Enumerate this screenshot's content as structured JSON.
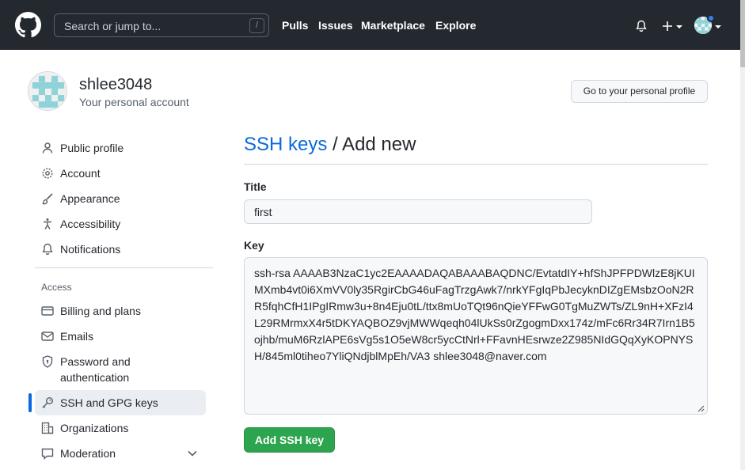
{
  "header": {
    "search_placeholder": "Search or jump to...",
    "search_shortcut": "/",
    "nav": [
      "Pulls",
      "Issues",
      "Marketplace",
      "Explore"
    ]
  },
  "profile": {
    "username": "shlee3048",
    "subtitle": "Your personal account",
    "go_profile_label": "Go to your personal profile"
  },
  "sidebar": {
    "items": [
      {
        "label": "Public profile",
        "icon": "person-icon"
      },
      {
        "label": "Account",
        "icon": "gear-icon"
      },
      {
        "label": "Appearance",
        "icon": "paintbrush-icon"
      },
      {
        "label": "Accessibility",
        "icon": "accessibility-icon"
      },
      {
        "label": "Notifications",
        "icon": "bell-icon"
      }
    ],
    "access_heading": "Access",
    "access_items": [
      {
        "label": "Billing and plans",
        "icon": "credit-card-icon"
      },
      {
        "label": "Emails",
        "icon": "mail-icon"
      },
      {
        "label": "Password and authentication",
        "icon": "shield-lock-icon"
      },
      {
        "label": "SSH and GPG keys",
        "icon": "key-icon",
        "active": true
      },
      {
        "label": "Organizations",
        "icon": "organization-icon"
      },
      {
        "label": "Moderation",
        "icon": "moderation-icon"
      }
    ]
  },
  "main": {
    "title_link": "SSH keys",
    "title_rest": "/ Add new",
    "title_label": "Title",
    "title_value": "first",
    "key_label": "Key",
    "key_value": "ssh-rsa AAAAB3NzaC1yc2EAAAADAQABAAABAQDNC/EvtatdIY+hfShJPFPDWlzE8jKUIMXmb4vt0i6XmVV0ly35RgirCbG46uFagTrzgAwk7/nrkYFgIqPbJecyknDIZgEMsbzOoN2RR5fqhCfH1IPgIRmw3u+8n4Eju0tL/ttx8mUoTQt96nQieYFFwG0TgMuZWTs/ZL9nH+XFzI4L29RMrmxX4r5tDKYAQBOZ9vjMWWqeqh04lUkSs0rZgogmDxx174z/mFc6Rr34R7Irn1B5ojhb/muM6RzlAPE6sVg5s1O5eW8cr5ycCtNrl+FFavnHEsrwze2Z985NIdGQqXyKOPNYSH/845ml0tiheo7YliQNdjblMpEh/VA3 shlee3048@naver.com",
    "submit_label": "Add SSH key"
  },
  "colors": {
    "header_bg": "#24292f",
    "link": "#0969da",
    "primary_button": "#2da44e",
    "active_indicator": "#0969da"
  }
}
